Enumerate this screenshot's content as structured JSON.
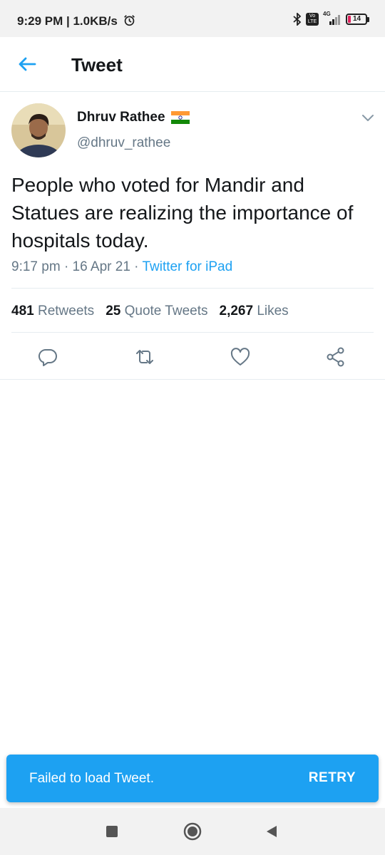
{
  "status_bar": {
    "time_speed": "9:29 PM | 1.0KB/s",
    "network": "4G",
    "volte": "Vo LTE",
    "battery": "14",
    "icons": [
      "alarm-icon",
      "bluetooth-icon",
      "volte-icon",
      "signal-icon",
      "battery-icon"
    ]
  },
  "app_bar": {
    "title": "Tweet",
    "back_icon": "arrow-left-icon"
  },
  "tweet": {
    "author_name": "Dhruv Rathee",
    "author_flag": "india-flag",
    "author_handle": "@dhruv_rathee",
    "text": "People who voted for Mandir and Statues are realizing the importance of hospitals today.",
    "time": "9:17 pm",
    "date": "16 Apr 21",
    "source": "Twitter for iPad",
    "sep": "·"
  },
  "stats": {
    "retweets_count": "481",
    "retweets_label": "Retweets",
    "quotes_count": "25",
    "quotes_label": "Quote Tweets",
    "likes_count": "2,267",
    "likes_label": "Likes"
  },
  "actions": [
    "reply-icon",
    "retweet-icon",
    "like-icon",
    "share-icon"
  ],
  "toast": {
    "message": "Failed to load Tweet.",
    "action": "RETRY"
  },
  "nav": [
    "recents-button",
    "home-button",
    "back-button"
  ],
  "colors": {
    "accent": "#1da1f2",
    "secondary_text": "#657786",
    "divider": "#e6ecf0"
  }
}
